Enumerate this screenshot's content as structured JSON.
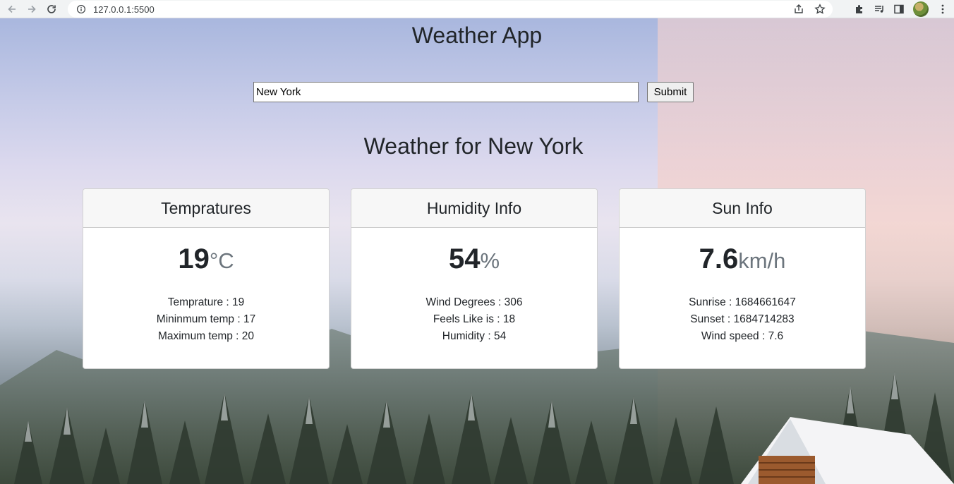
{
  "browser": {
    "url": "127.0.0.1:5500"
  },
  "page": {
    "title": "Weather App",
    "search": {
      "value": "New York",
      "submit_label": "Submit"
    },
    "subtitle": "Weather for New York",
    "cards": [
      {
        "header": "Tempratures",
        "value": "19",
        "unit": "°C",
        "lines": [
          "Temprature : 19",
          "Mininmum temp : 17",
          "Maximum temp : 20"
        ]
      },
      {
        "header": "Humidity Info",
        "value": "54",
        "unit": "%",
        "lines": [
          "Wind Degrees : 306",
          "Feels Like is : 18",
          "Humidity : 54"
        ]
      },
      {
        "header": "Sun Info",
        "value": "7.6",
        "unit": "km/h",
        "lines": [
          "Sunrise : 1684661647",
          "Sunset : 1684714283",
          "Wind speed : 7.6"
        ]
      }
    ]
  },
  "icons": [
    "back-arrow-icon",
    "forward-arrow-icon",
    "reload-icon",
    "info-icon",
    "share-icon",
    "star-icon",
    "extensions-icon",
    "media-icon",
    "sidepanel-icon",
    "profile-avatar",
    "more-icon"
  ]
}
